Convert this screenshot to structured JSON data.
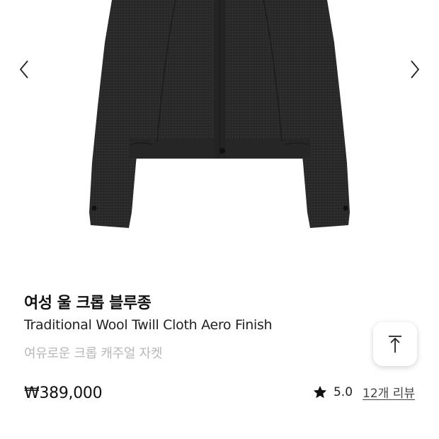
{
  "gallery": {
    "image_subject": "dark charcoal wool cropped jacket"
  },
  "product": {
    "name_ko": "여성 울 크롭 블루종",
    "name_en": "Traditional Wool Twill Cloth Aero Finish",
    "description": "여유로운 크롭 캐주얼 자켓",
    "price": "₩389,000"
  },
  "rating": {
    "score": "5.0",
    "review_link": "12개 리뷰"
  },
  "icons": {
    "prev": "chevron-left-icon",
    "next": "chevron-right-icon",
    "star": "star-icon",
    "top": "arrow-up-to-top-icon"
  },
  "colors": {
    "text_primary": "#111111",
    "text_muted": "#b8b8b8",
    "jacket": "#2b2b2b"
  }
}
